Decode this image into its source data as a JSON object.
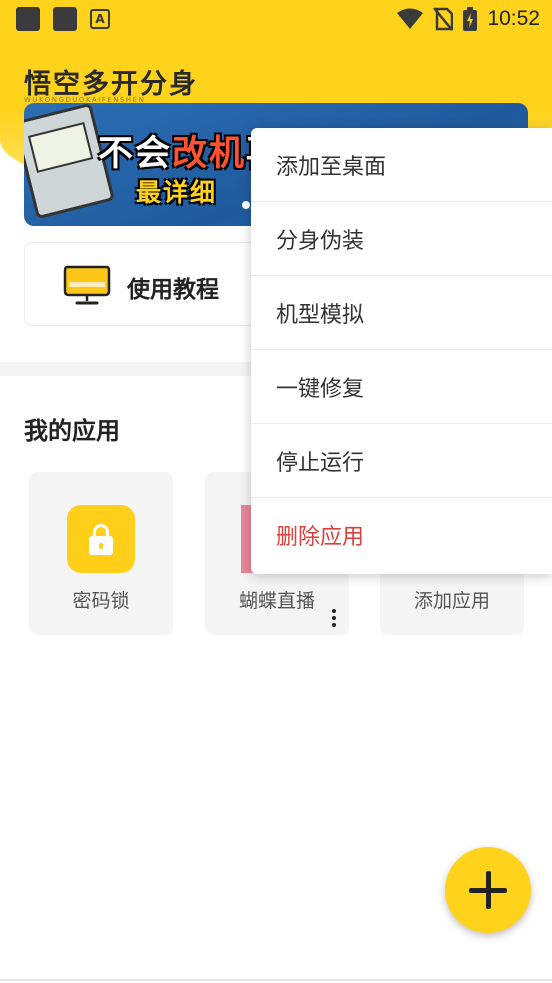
{
  "status_bar": {
    "time": "10:52",
    "icons": [
      "notification-icon",
      "notification-icon",
      "app-store-icon",
      "wifi-icon",
      "no-sim-icon",
      "battery-charging-icon"
    ]
  },
  "header": {
    "title": "悟空多开分身",
    "subtitle": "WUKONGDUOKAIFENSHEN"
  },
  "banner": {
    "line1_prefix": "不会",
    "line1_highlight": "改机",
    "line1_suffix": "再往",
    "line2": "最详细"
  },
  "tutorial": {
    "label": "使用教程",
    "icon": "monitor-icon"
  },
  "my_apps": {
    "title": "我的应用",
    "apps": [
      {
        "label": "密码锁",
        "icon": "lock-icon"
      },
      {
        "label": "蝴蝶直播",
        "icon": "butterfly-app-icon"
      },
      {
        "label": "添加应用",
        "icon": "add-app-icon"
      }
    ]
  },
  "context_menu": {
    "items": [
      {
        "label": "添加至桌面"
      },
      {
        "label": "分身伪装"
      },
      {
        "label": "机型模拟"
      },
      {
        "label": "一键修复"
      },
      {
        "label": "停止运行"
      },
      {
        "label": "删除应用",
        "color": "#d9413a"
      }
    ]
  },
  "fab": {
    "icon": "plus-icon"
  },
  "colors": {
    "brand_yellow": "#ffd21c",
    "danger": "#d9413a"
  }
}
